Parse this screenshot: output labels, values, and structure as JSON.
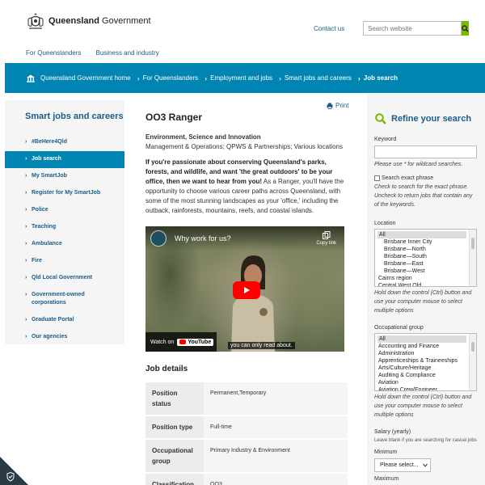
{
  "header": {
    "brand_bold": "Queensland",
    "brand_rest": " Government",
    "contact": "Contact us",
    "search_placeholder": "Search website"
  },
  "subnav": [
    "For Queenslanders",
    "Business and industry"
  ],
  "breadcrumb": [
    {
      "label": "Queensland Government home"
    },
    {
      "label": "For Queenslanders"
    },
    {
      "label": "Employment and jobs"
    },
    {
      "label": "Smart jobs and careers"
    },
    {
      "label": "Job search"
    }
  ],
  "sidebar": {
    "title": "Smart jobs and careers",
    "items": [
      "#BeHere4Qld",
      "Job search",
      "My SmartJob",
      "Register for My SmartJob",
      "Police",
      "Teaching",
      "Ambulance",
      "Fire",
      "Qld Local Government",
      "Government-owned corporations",
      "Graduate Portal",
      "Our agencies"
    ],
    "active_index": 1
  },
  "main": {
    "print": "Print",
    "title": "OO3 Ranger",
    "department": "Environment, Science and Innovation",
    "categories": "Management & Operations; QPWS & Partnerships; Various locations",
    "intro_bold": "If you're passionate about conserving Queensland's parks, forests, and wildlife, and want 'the great outdoors' to be your office, then we want to hear from you!",
    "intro_rest": " As a Ranger, you'll have the opportunity to choose various career paths across Queensland, with some of the most stunning landscapes as your 'office,' including the outback, rainforests, mountains, reefs, and coastal islands.",
    "video": {
      "title": "Why work for us?",
      "copy_link": "Copy link",
      "watch_on": "Watch on",
      "youtube": "YouTube",
      "caption": "you can only read about."
    },
    "job_details_title": "Job details",
    "job_details": [
      {
        "key": "Position status",
        "value": "Permanent,Temporary"
      },
      {
        "key": "Position type",
        "value": "Full-time"
      },
      {
        "key": "Occupational group",
        "value": "Primary Industry & Environment"
      },
      {
        "key": "Classification",
        "value": "OO3"
      }
    ]
  },
  "refine": {
    "title": "Refine your search",
    "keyword_label": "Keyword",
    "keyword_help": "Please use * for wildcard searches.",
    "exact_label": "Search exact phrase",
    "exact_help": "Check to search for the exact phrase. Uncheck to return jobs that contain any of the keywords.",
    "location_label": "Location",
    "location_options": [
      {
        "label": "All",
        "selected": true,
        "indent": false
      },
      {
        "label": "Brisbane Inner City",
        "selected": false,
        "indent": true
      },
      {
        "label": "Brisbane—North",
        "selected": false,
        "indent": true
      },
      {
        "label": "Brisbane—South",
        "selected": false,
        "indent": true
      },
      {
        "label": "Brisbane—East",
        "selected": false,
        "indent": true
      },
      {
        "label": "Brisbane—West",
        "selected": false,
        "indent": true
      },
      {
        "label": "Cairns region",
        "selected": false,
        "indent": false
      },
      {
        "label": "Central West Qld",
        "selected": false,
        "indent": false
      }
    ],
    "multi_help": "Hold down the control (Ctrl) button and use your computer mouse to select multiple options",
    "occ_label": "Occupational group",
    "occ_options": [
      {
        "label": "All",
        "selected": true
      },
      {
        "label": "Accounting and Finance",
        "selected": false
      },
      {
        "label": "Administration",
        "selected": false
      },
      {
        "label": "Apprenticeships & Traineeships",
        "selected": false
      },
      {
        "label": "Arts/Culture/Heritage",
        "selected": false
      },
      {
        "label": "Auditing & Compliance",
        "selected": false
      },
      {
        "label": "Aviation",
        "selected": false
      },
      {
        "label": "Aviation Crew/Engineer",
        "selected": false
      }
    ],
    "salary_label": "Salary (yearly)",
    "salary_help": "Leave blank if you are searching for casual jobs",
    "minimum_label": "Minimum",
    "minimum_value": "Please select...",
    "maximum_label": "Maximum"
  },
  "colors": {
    "brand_blue": "#0085b3",
    "link_blue": "#1a5c86",
    "search_green": "#78ba00"
  }
}
